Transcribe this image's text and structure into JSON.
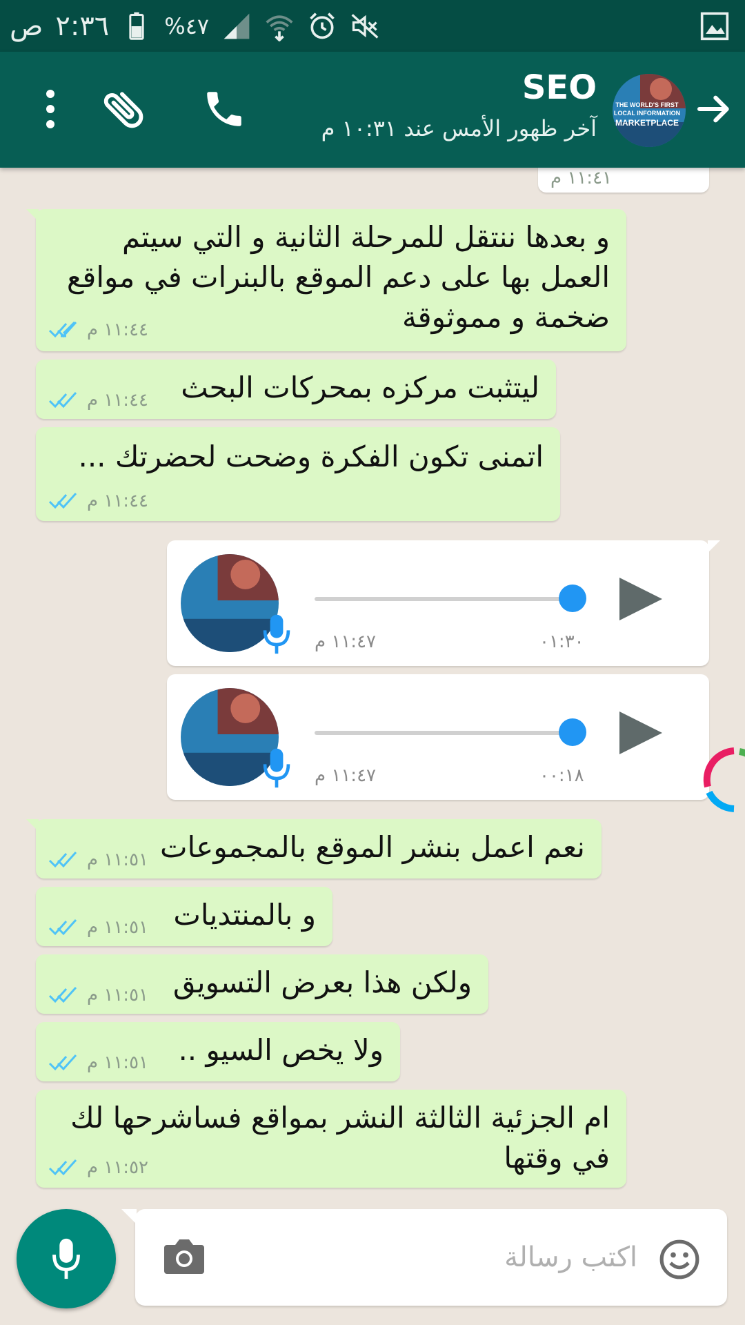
{
  "status_bar": {
    "time": "٢:٣٦",
    "ampm": "ص",
    "battery": "%٤٧"
  },
  "header": {
    "contact_name": "SEO",
    "last_seen": "آخر ظهور الأمس عند ١٠:٣١ م",
    "avatar_text": [
      "THE WORLD'S FIRST",
      "LOCAL INFORMATION",
      "MARKETPLACE"
    ]
  },
  "messages": [
    {
      "text": "و بعدها ننتقل للمرحلة الثانية و التي سيتم العمل بها على دعم الموقع بالبنرات في مواقع ضخمة و مموثوقة",
      "time": "١١:٤٤ م"
    },
    {
      "text": "ليتثبت مركزه بمحركات البحث",
      "time": "١١:٤٤ م"
    },
    {
      "text": "اتمنى تكون الفكرة وضحت لحضرتك ...",
      "time": "١١:٤٤ م"
    },
    {
      "text": "نعم اعمل بنشر الموقع بالمجموعات",
      "time": "١١:٥١ م"
    },
    {
      "text": "و بالمنتديات",
      "time": "١١:٥١ م"
    },
    {
      "text": "ولكن هذا بعرض التسويق",
      "time": "١١:٥١ م"
    },
    {
      "text": "ولا يخص السيو ..",
      "time": "١١:٥١ م"
    },
    {
      "text": "ام الجزئية الثالثة النشر بمواقع فساشرحها لك في وقتها",
      "time": "١١:٥٢ م"
    }
  ],
  "top_cut": {
    "time": "١١:٤١ م"
  },
  "voice_notes": [
    {
      "time": "١١:٤٧ م",
      "duration": "٠١:٣٠",
      "progress": 1.0
    },
    {
      "time": "١١:٤٧ م",
      "duration": "٠٠:١٨",
      "progress": 1.0
    }
  ],
  "input": {
    "placeholder": "اكتب رسالة"
  },
  "colors": {
    "header": "#075e54",
    "status_bar": "#054d44",
    "outgoing": "#dcf8c6",
    "fab": "#00897b",
    "ticks": "#4fc3f7"
  },
  "icons": [
    "back-arrow-icon",
    "phone-icon",
    "attach-icon",
    "menu-icon",
    "mic-icon",
    "camera-icon",
    "emoji-icon",
    "play-icon",
    "double-tick-icon"
  ]
}
